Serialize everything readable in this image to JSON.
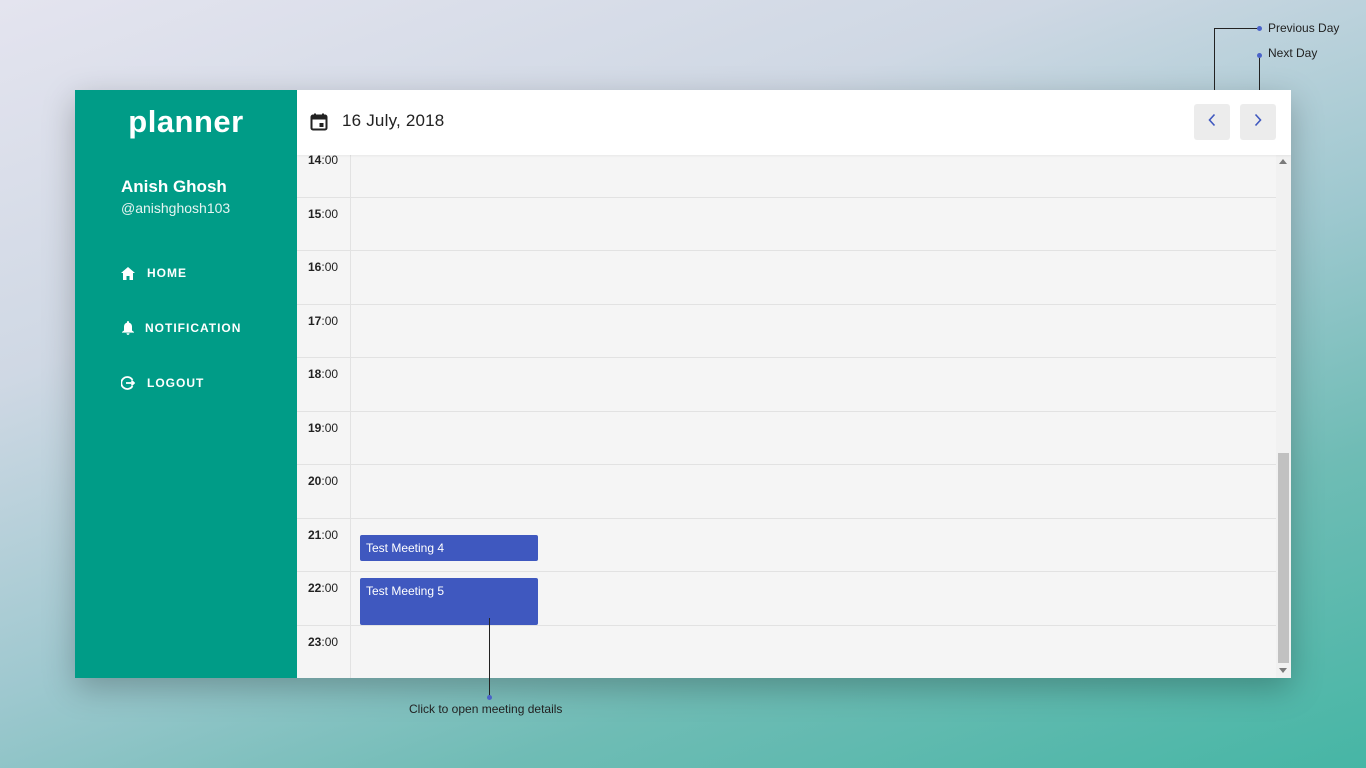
{
  "sidebar": {
    "brand": "planner",
    "user": {
      "name": "Anish Ghosh",
      "handle": "@anishghosh103"
    },
    "nav": [
      {
        "label": "HOME",
        "icon": "home-icon"
      },
      {
        "label": "NOTIFICATION",
        "icon": "bell-icon"
      },
      {
        "label": "LOGOUT",
        "icon": "logout-icon"
      }
    ]
  },
  "header": {
    "date": "16 July, 2018",
    "calendar_icon": "calendar-icon",
    "prev_icon": "chevron-left-icon",
    "next_icon": "chevron-right-icon"
  },
  "timeline": {
    "hours": [
      {
        "h": "14",
        "m": ":00"
      },
      {
        "h": "15",
        "m": ":00"
      },
      {
        "h": "16",
        "m": ":00"
      },
      {
        "h": "17",
        "m": ":00"
      },
      {
        "h": "18",
        "m": ":00"
      },
      {
        "h": "19",
        "m": ":00"
      },
      {
        "h": "20",
        "m": ":00"
      },
      {
        "h": "21",
        "m": ":00"
      },
      {
        "h": "22",
        "m": ":00"
      },
      {
        "h": "23",
        "m": ":00"
      }
    ],
    "events": [
      {
        "title": "Test Meeting 4"
      },
      {
        "title": "Test Meeting 5"
      }
    ]
  },
  "annotations": {
    "previous_day": "Previous Day",
    "next_day": "Next Day",
    "meeting_details": "Click to open meeting details"
  },
  "colors": {
    "sidebar": "#009c87",
    "event": "#3f58bf",
    "annotation_dot": "#4a63c9"
  }
}
